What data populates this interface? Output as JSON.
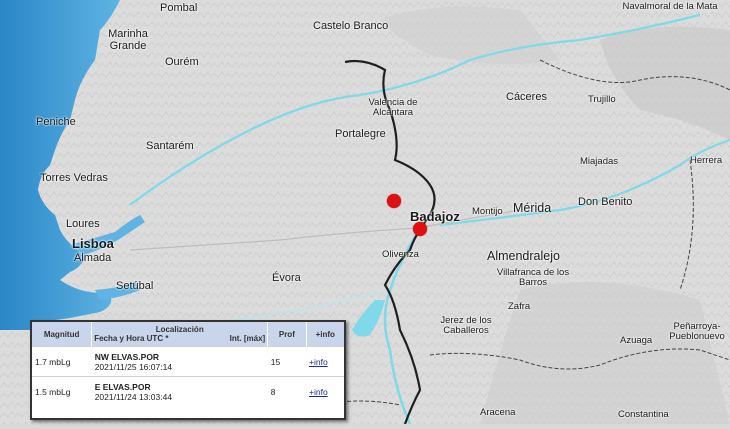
{
  "map": {
    "places": [
      {
        "name": "Pombal"
      },
      {
        "name": "Marinha Grande"
      },
      {
        "name": "Ourém"
      },
      {
        "name": "Castelo Branco"
      },
      {
        "name": "Navalmoral de la Mata"
      },
      {
        "name": "Peniche"
      },
      {
        "name": "Valencia de Alcántara"
      },
      {
        "name": "Portalegre"
      },
      {
        "name": "Cáceres"
      },
      {
        "name": "Trujillo"
      },
      {
        "name": "Santarém"
      },
      {
        "name": "Torres Vedras"
      },
      {
        "name": "Miajadas"
      },
      {
        "name": "Herrera"
      },
      {
        "name": "Badajoz"
      },
      {
        "name": "Montijo"
      },
      {
        "name": "Mérida"
      },
      {
        "name": "Don Benito"
      },
      {
        "name": "Loures"
      },
      {
        "name": "Lisboa"
      },
      {
        "name": "Almada"
      },
      {
        "name": "Olivenza"
      },
      {
        "name": "Almendralejo"
      },
      {
        "name": "Évora"
      },
      {
        "name": "Villafranca de los Barros"
      },
      {
        "name": "Setúbal"
      },
      {
        "name": "Zafra"
      },
      {
        "name": "Jerez de los Caballeros"
      },
      {
        "name": "Peñarroya-Pueblonuevo"
      },
      {
        "name": "Azuaga"
      },
      {
        "name": "Aracena"
      },
      {
        "name": "Constantina"
      }
    ],
    "colors": {
      "sea": "#3a9bd5",
      "land": "#d9d9d9",
      "river": "#6fd3e3",
      "border": "#222222",
      "epicenter": "#e01010"
    }
  },
  "legend": {
    "headers": {
      "magnitude": "Magnitud",
      "localization": "Localización",
      "datetime": "Fecha y Hora UTC *",
      "intensity": "Int. [máx]",
      "depth": "Prof",
      "info": "+info"
    },
    "rows": [
      {
        "magnitude": "1.7 mbLg",
        "location": "NW ELVAS.POR",
        "datetime": "2021/11/25 16:07:14",
        "intensity": "",
        "depth": "15",
        "info": "+info"
      },
      {
        "magnitude": "1.5 mbLg",
        "location": "E ELVAS.POR",
        "datetime": "2021/11/24 13:03:44",
        "intensity": "",
        "depth": "8",
        "info": "+info"
      }
    ]
  }
}
